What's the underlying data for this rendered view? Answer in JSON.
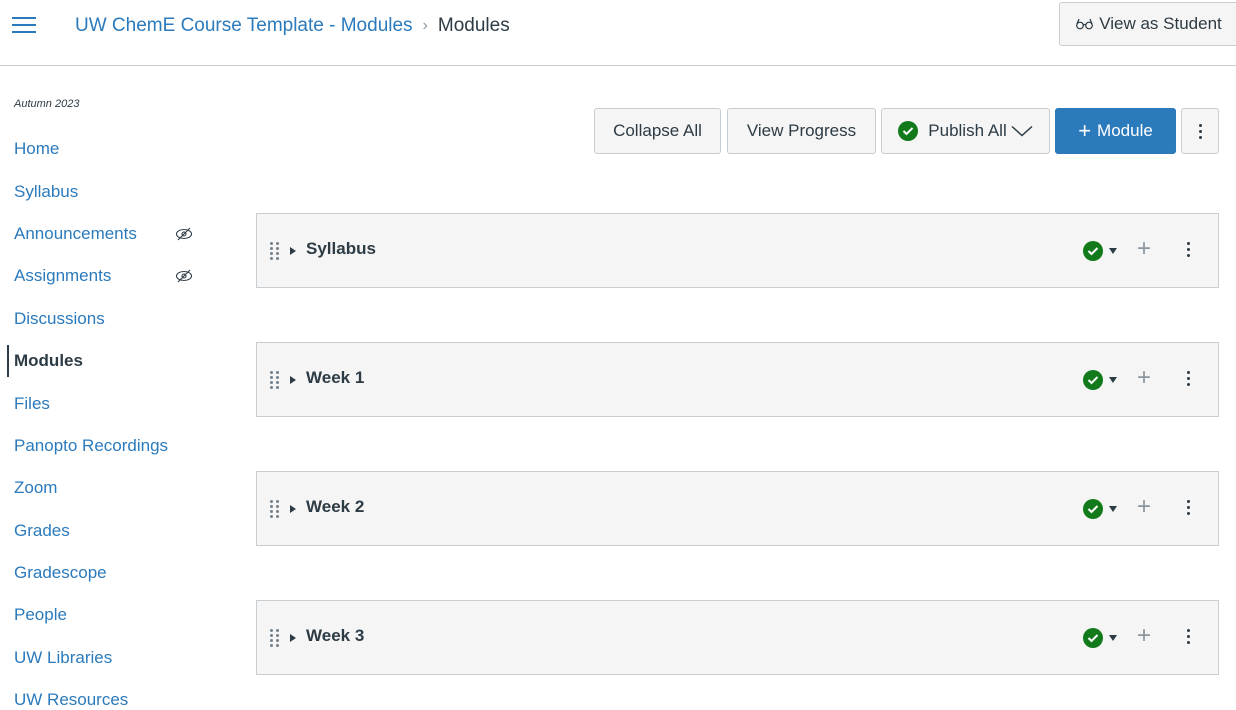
{
  "header": {
    "breadcrumb_course": "UW ChemE Course Template - Modules",
    "breadcrumb_separator": "›",
    "breadcrumb_current": "Modules",
    "view_as_student_icon": "glasses-icon",
    "view_as_student_label": "View as Student"
  },
  "sidebar": {
    "term": "Autumn 2023",
    "items": [
      {
        "label": "Home"
      },
      {
        "label": "Syllabus"
      },
      {
        "label": "Announcements",
        "hidden_from_students": true
      },
      {
        "label": "Assignments",
        "hidden_from_students": true
      },
      {
        "label": "Discussions"
      },
      {
        "label": "Modules",
        "active": true
      },
      {
        "label": "Files"
      },
      {
        "label": "Panopto Recordings"
      },
      {
        "label": "Zoom"
      },
      {
        "label": "Grades"
      },
      {
        "label": "Gradescope"
      },
      {
        "label": "People"
      },
      {
        "label": "UW Libraries"
      },
      {
        "label": "UW Resources"
      }
    ]
  },
  "toolbar": {
    "collapse_all": "Collapse All",
    "view_progress": "View Progress",
    "publish_all": "Publish All",
    "add_module_plus": "+",
    "add_module": "Module"
  },
  "modules": [
    {
      "title": "Syllabus",
      "published": true
    },
    {
      "title": "Week 1",
      "published": true
    },
    {
      "title": "Week 2",
      "published": true
    },
    {
      "title": "Week 3",
      "published": true
    }
  ],
  "module_add_glyph": "+",
  "colors": {
    "link": "#2b7abc",
    "text": "#2d3b45",
    "published": "#127a1b",
    "primary_button": "#2b7abc",
    "panel_bg": "#f5f5f5"
  }
}
